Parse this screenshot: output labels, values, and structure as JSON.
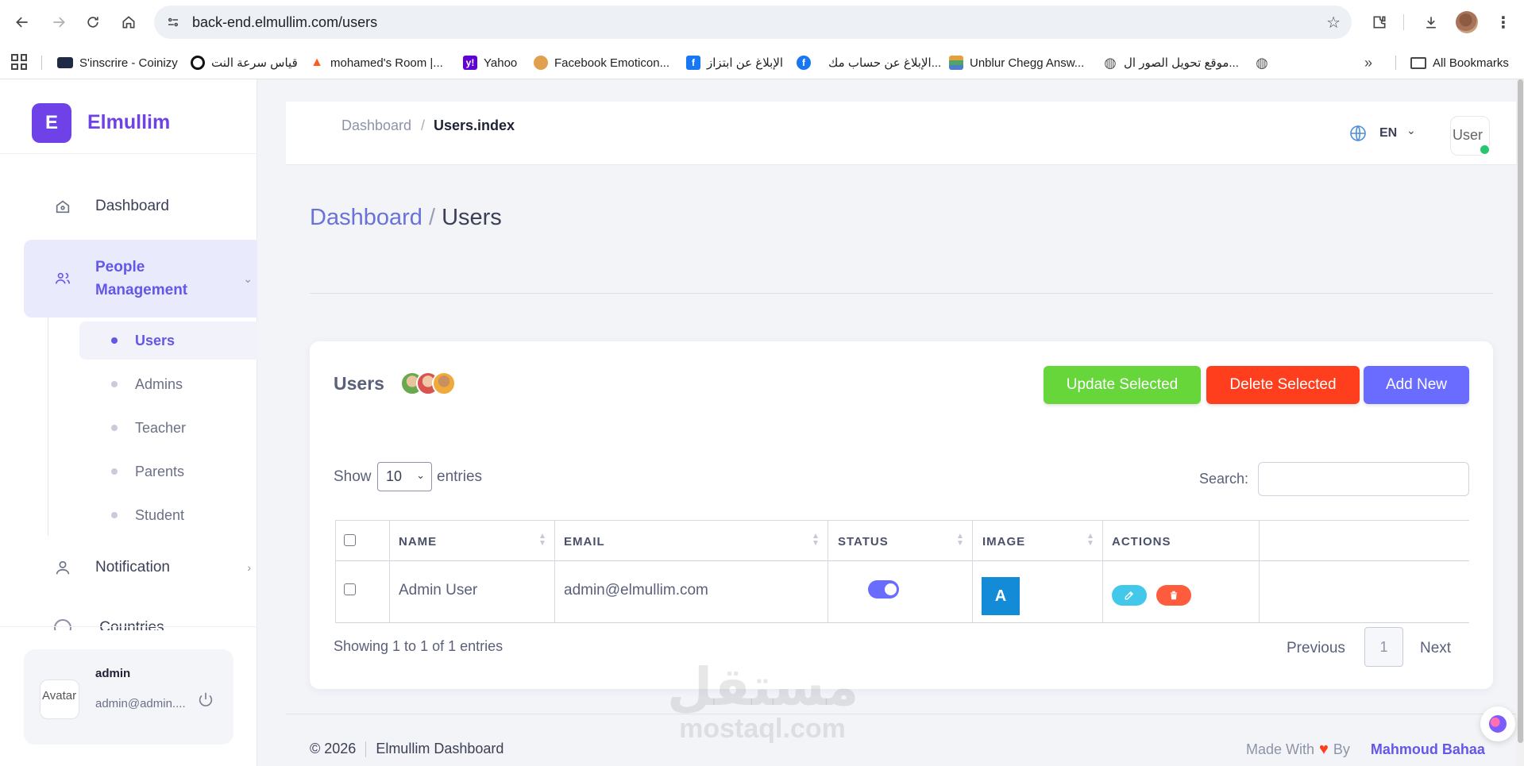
{
  "browser": {
    "url": "back-end.elmullim.com/users",
    "bookmarks": [
      {
        "label": "S'inscrire - Coinizy",
        "icon": "coinizy-icon",
        "color": "#1f2a44"
      },
      {
        "label": "قياس سرعة النت",
        "icon": "speedtest-icon",
        "color": "#111111"
      },
      {
        "label": "mohamed's Room |...",
        "icon": "flame-icon",
        "color": "#ff5a1f"
      },
      {
        "label": "Yahoo",
        "icon": "yahoo-icon",
        "color": "#6001d2"
      },
      {
        "label": "Facebook Emoticon...",
        "icon": "cookie-icon",
        "color": "#e0a050"
      },
      {
        "label": "الإبلاغ عن ابتزاز",
        "icon": "facebook-square-icon",
        "color": "#1877f2"
      },
      {
        "label": "الإبلاغ عن حساب مك...",
        "icon": "facebook-round-icon",
        "color": "#1877f2"
      },
      {
        "label": "Unblur Chegg Answ...",
        "icon": "books-icon",
        "color": "#e2a03f"
      },
      {
        "label": "موقع تحويل الصور ال...",
        "icon": "globe-icon",
        "color": "#555555"
      }
    ],
    "all_bookmarks": "All Bookmarks"
  },
  "sidebar": {
    "logo_letter": "E",
    "app_name": "Elmullim",
    "menu": {
      "dashboard": "Dashboard",
      "people_line1": "People",
      "people_line2": "Management",
      "notification": "Notification",
      "cut_item": "Countries"
    },
    "submenu": [
      "Users",
      "Admins",
      "Teacher",
      "Parents",
      "Student"
    ],
    "user": {
      "avatar_alt": "Avatar",
      "name": "admin",
      "email": "admin@admin...."
    }
  },
  "topbar": {
    "crumb_home": "Dashboard",
    "crumb_sep": "/",
    "crumb_current": "Users.index",
    "language": "EN",
    "avatar_alt": "User"
  },
  "page": {
    "heading_link": "Dashboard",
    "heading_sep": "/",
    "heading_current": "Users"
  },
  "card": {
    "title": "Users",
    "buttons": {
      "update": "Update Selected",
      "delete": "Delete Selected",
      "add": "Add New"
    },
    "show_label": "Show",
    "page_size": "10",
    "entries_label": "entries",
    "search_label": "Search:",
    "columns": [
      "NAME",
      "EMAIL",
      "STATUS",
      "IMAGE",
      "ACTIONS"
    ],
    "rows": [
      {
        "name": "Admin User",
        "email": "admin@elmullim.com",
        "status": true,
        "image_letter": "A"
      }
    ],
    "showing": "Showing 1 to 1 of 1 entries",
    "pagination": {
      "previous": "Previous",
      "current": "1",
      "next": "Next"
    }
  },
  "footer": {
    "copyright": "© 2026",
    "app": "Elmullim Dashboard",
    "made_with": "Made With",
    "by": "By",
    "author": "Mahmoud Bahaa"
  },
  "watermark": {
    "arabic": "مستقل",
    "latin": "mostaql.com"
  },
  "colors": {
    "brand": "#6f42e8",
    "primary": "#696cff",
    "success": "#66d63b",
    "danger": "#ff3e1d",
    "info": "#42c8ea",
    "online": "#28c76f"
  }
}
